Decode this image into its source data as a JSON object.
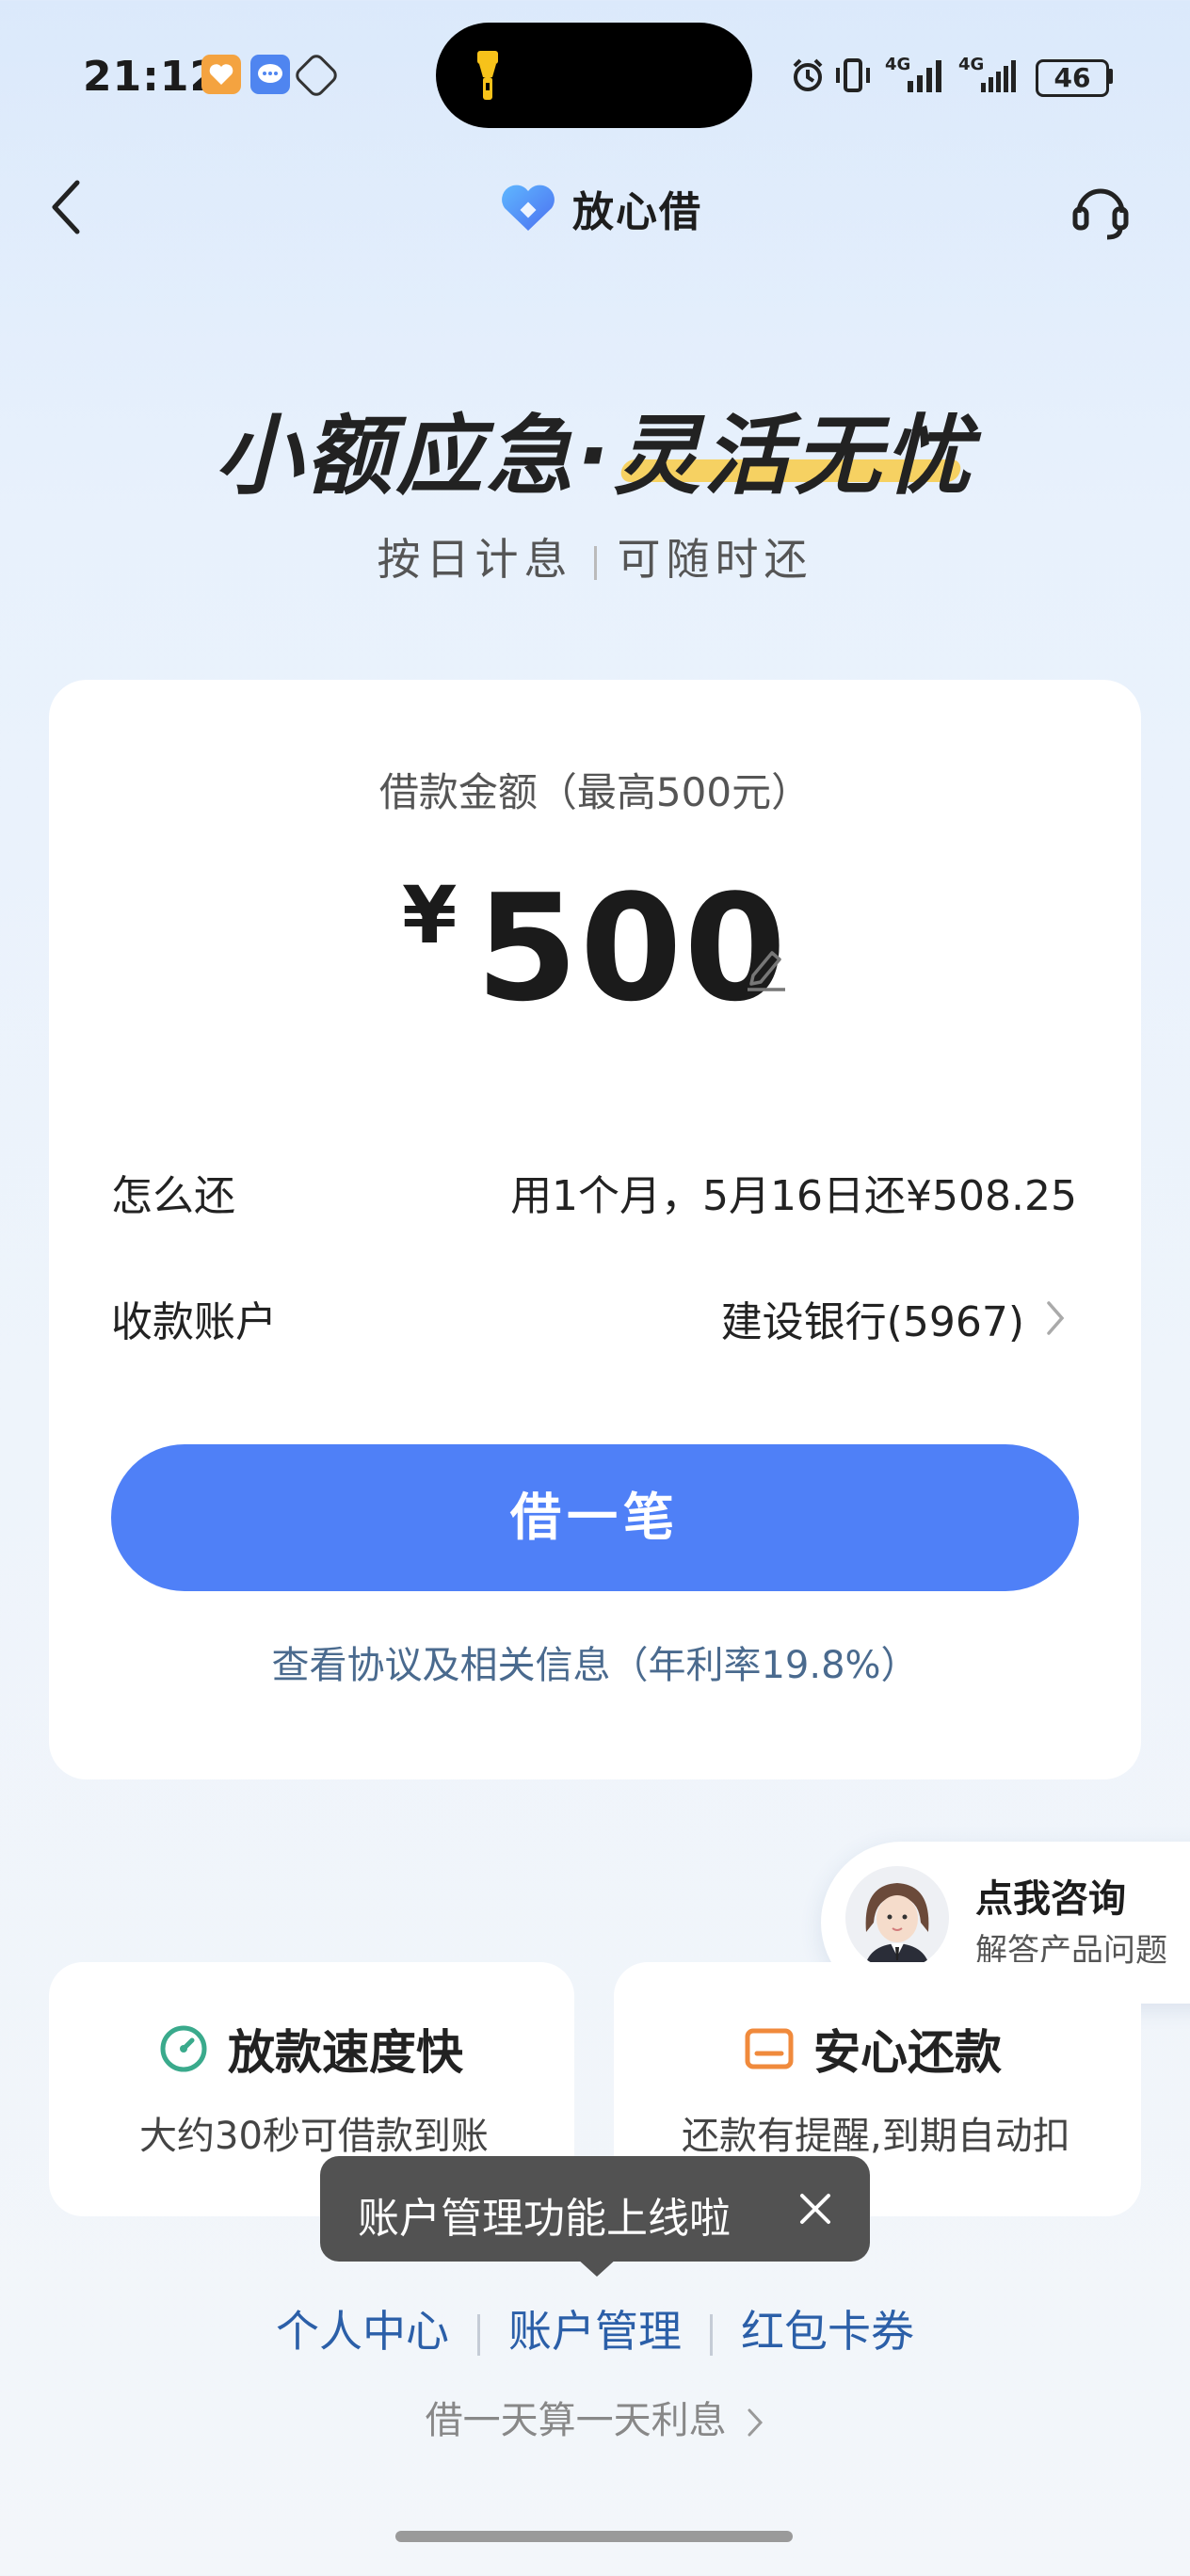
{
  "status_bar": {
    "time": "21:12",
    "battery": "46",
    "network_1": "4G",
    "network_2": "4G"
  },
  "header": {
    "brand_name": "放心借"
  },
  "hero": {
    "title": "小额应急·灵活无忧",
    "sub_left": "按日计息",
    "sub_right": "可随时还"
  },
  "loan": {
    "amount_label": "借款金额（最高500元）",
    "currency": "¥",
    "amount": "500",
    "repay_label": "怎么还",
    "repay_value": "用1个月，5月16日还¥508.25",
    "account_label": "收款账户",
    "account_value": "建设银行(5967)",
    "cta_label": "借一笔",
    "agreement": "查看协议及相关信息（年利率19.8%）"
  },
  "consult": {
    "title": "点我咨询",
    "subtitle": "解答产品问题"
  },
  "features": [
    {
      "title": "放款速度快",
      "desc": "大约30秒可借款到账"
    },
    {
      "title": "安心还款",
      "desc": "还款有提醒,到期自动扣"
    }
  ],
  "toast": {
    "text": "账户管理功能上线啦"
  },
  "bottom_nav": {
    "links": [
      "个人中心",
      "账户管理",
      "红包卡券"
    ],
    "note": "借一天算一天利息"
  },
  "colors": {
    "primary": "#4f80f7",
    "accent_yellow": "#f7cf5a",
    "feature_green": "#3aaa8c",
    "feature_orange": "#f08a3c"
  }
}
